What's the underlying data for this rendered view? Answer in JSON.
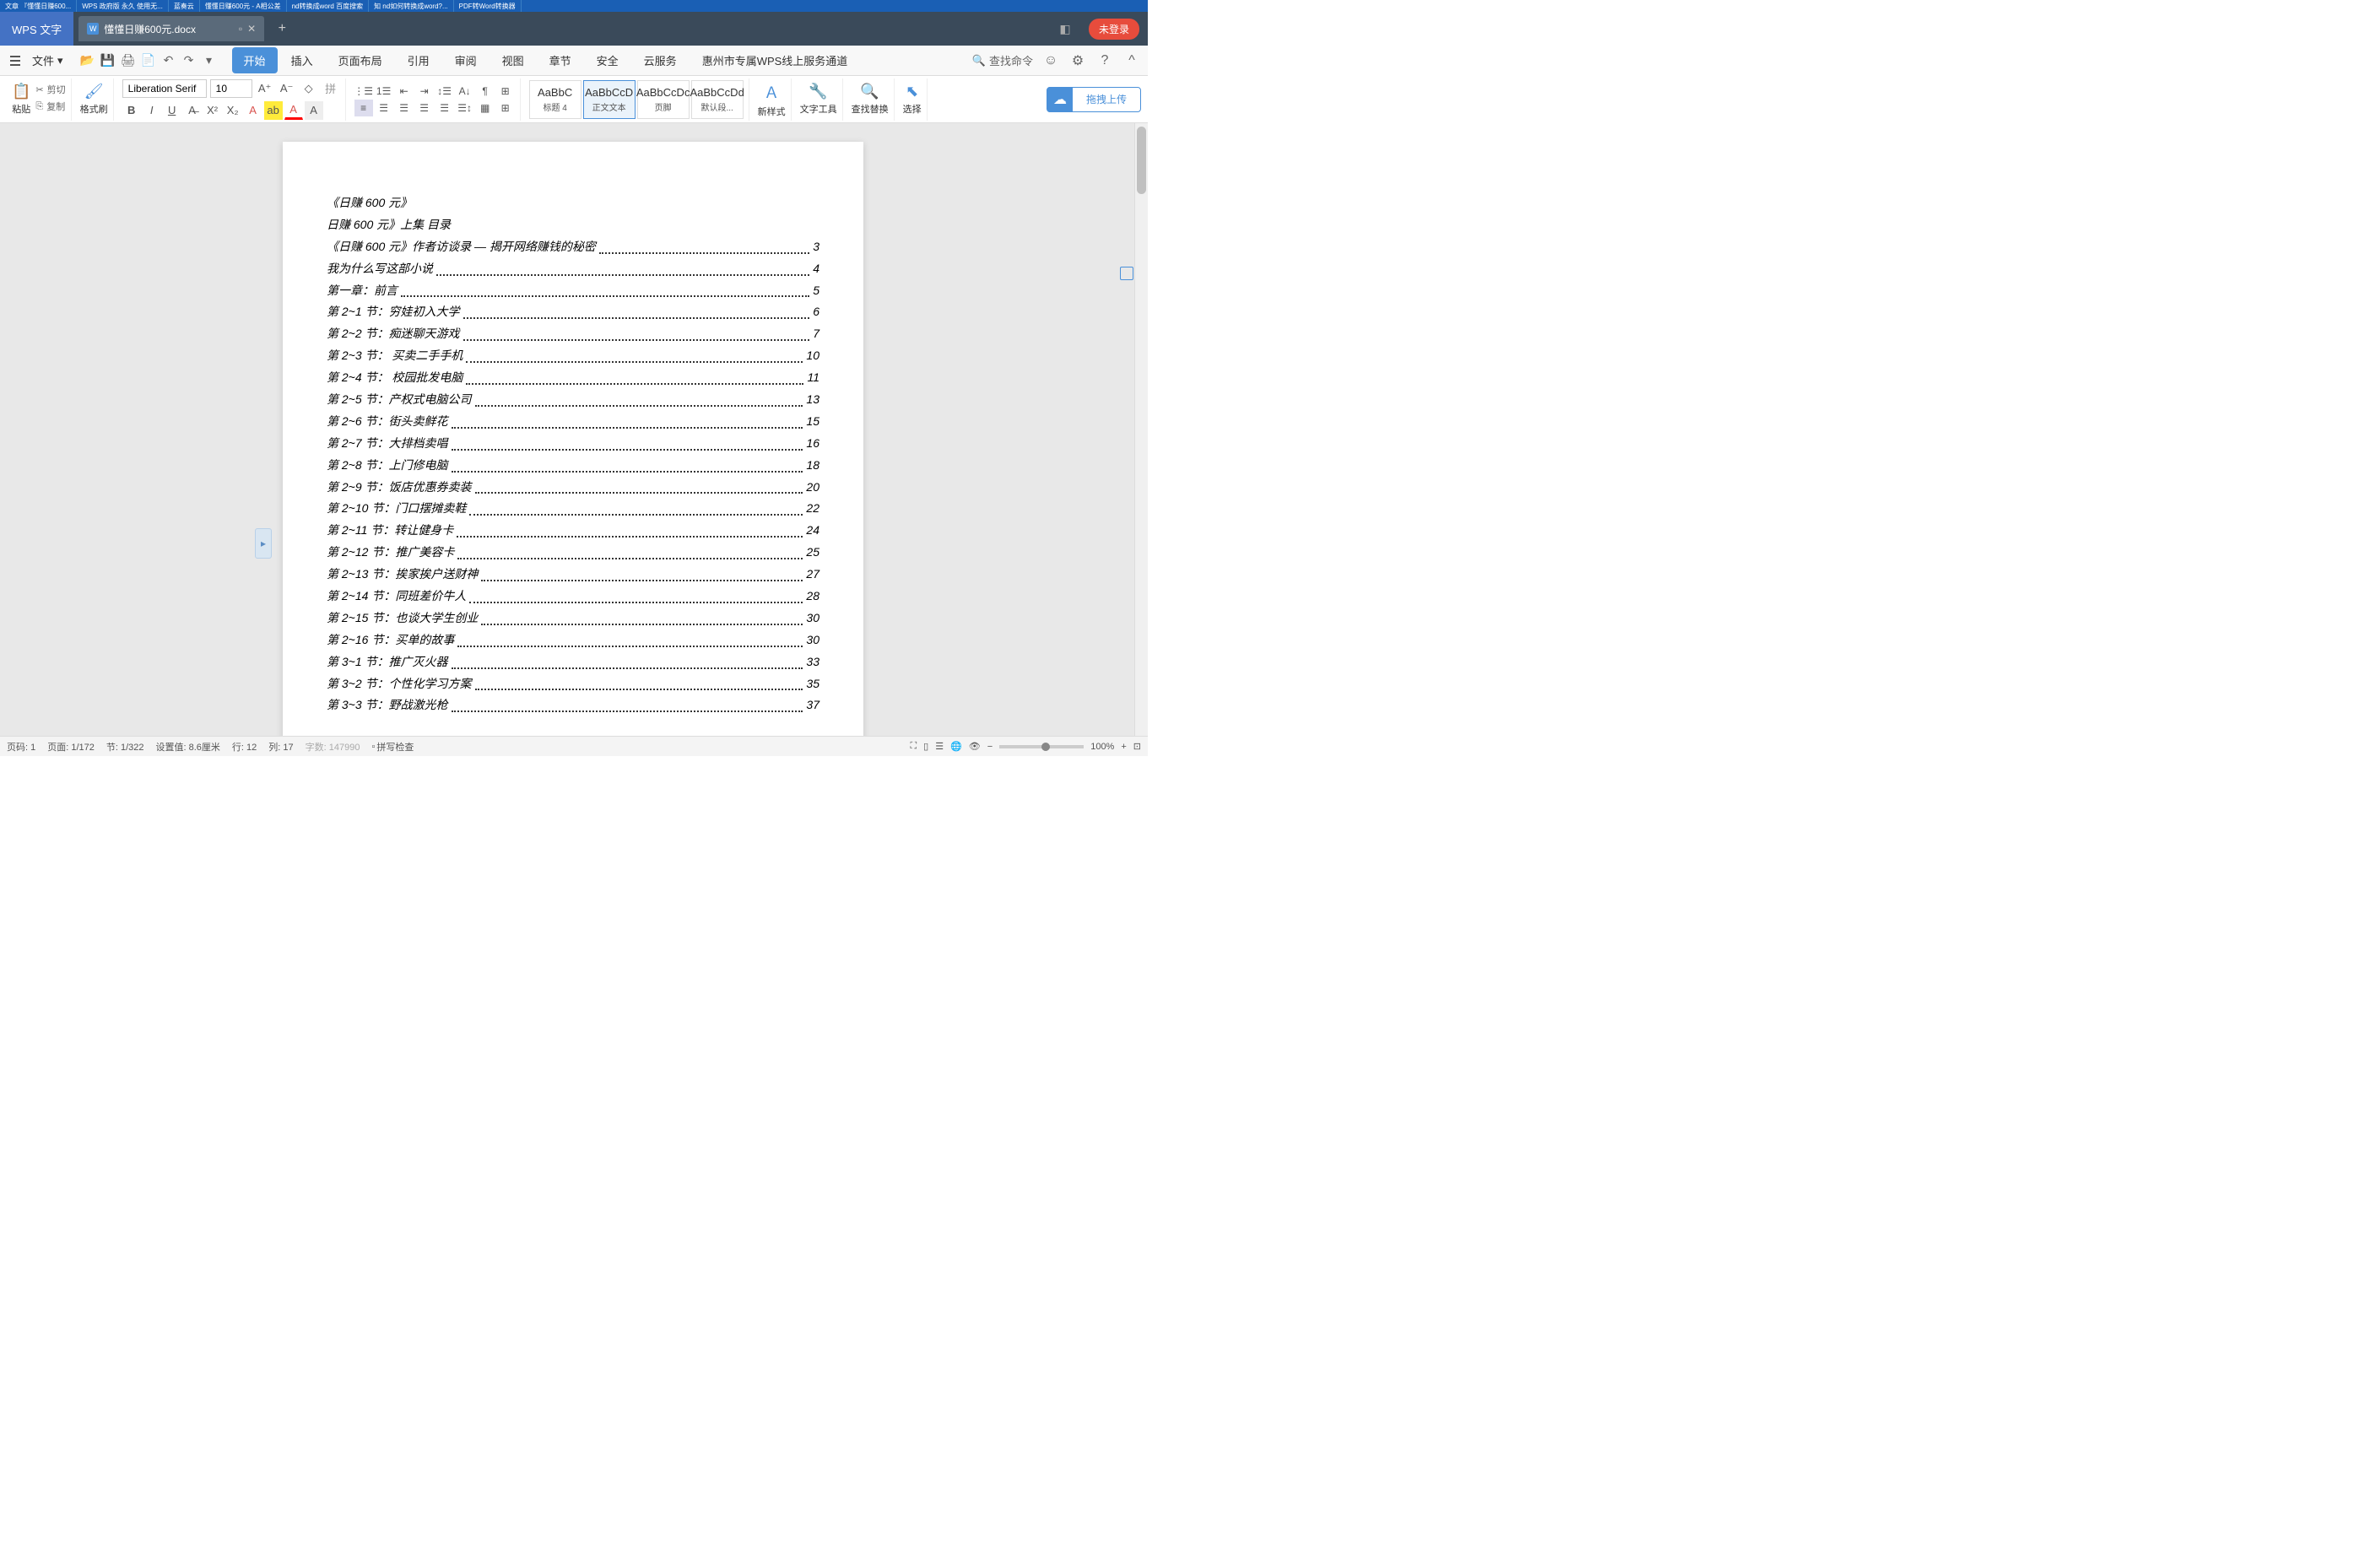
{
  "browser_tabs": [
    "文章 『懂懂日赚600...",
    "WPS 政府版 永久 使用无...",
    "蓝奏云",
    "懂懂日赚600元 - A相公差",
    "nd转换成word 百度搜索",
    "知 nd如何转换成word?...",
    "PDF转Word转换器"
  ],
  "app": {
    "name": "WPS 文字",
    "login": "未登录"
  },
  "doc_tab": {
    "icon": "W",
    "name": "懂懂日赚600元.docx"
  },
  "file_menu": "文件",
  "tabs": [
    "开始",
    "插入",
    "页面布局",
    "引用",
    "审阅",
    "视图",
    "章节",
    "安全",
    "云服务",
    "惠州市专属WPS线上服务通道"
  ],
  "search_cmd": "查找命令",
  "clipboard": {
    "paste": "粘贴",
    "cut": "剪切",
    "copy": "复制",
    "format": "格式刷"
  },
  "font": {
    "family": "Liberation Serif",
    "size": "10"
  },
  "styles": [
    {
      "preview": "AaBbC",
      "label": "标题 4"
    },
    {
      "preview": "AaBbCcD",
      "label": "正文文本"
    },
    {
      "preview": "AaBbCcDc",
      "label": "页脚"
    },
    {
      "preview": "AaBbCcDd",
      "label": "默认段..."
    }
  ],
  "ribbon_right": {
    "newstyle": "新样式",
    "texttools": "文字工具",
    "findreplace": "查找替换",
    "select": "选择",
    "upload": "拖拽上传"
  },
  "document": {
    "title": "《日赚 600 元》",
    "subtitle": "日赚 600 元》上集 目录",
    "toc": [
      {
        "text": "《日赚 600 元》作者访谈录 — 揭开网络赚钱的秘密",
        "page": "3"
      },
      {
        "text": "我为什么写这部小说",
        "page": "4"
      },
      {
        "text": "第一章：前言",
        "page": "5"
      },
      {
        "text": "第 2~1 节：穷娃初入大学",
        "page": "6"
      },
      {
        "text": "第 2~2 节：痴迷聊天游戏",
        "page": "7"
      },
      {
        "text": "第 2~3 节： 买卖二手手机",
        "page": "10"
      },
      {
        "text": "第 2~4 节： 校园批发电脑",
        "page": "11"
      },
      {
        "text": "第 2~5 节：产权式电脑公司",
        "page": "13"
      },
      {
        "text": "第 2~6 节：街头卖鲜花",
        "page": "15"
      },
      {
        "text": "第 2~7 节：大排档卖唱",
        "page": "16"
      },
      {
        "text": "第 2~8 节：上门修电脑",
        "page": "18"
      },
      {
        "text": "第 2~9 节：饭店优惠券卖装",
        "page": "20"
      },
      {
        "text": "第 2~10 节：门口摆摊卖鞋",
        "page": "22"
      },
      {
        "text": "第 2~11 节：转让健身卡",
        "page": "24"
      },
      {
        "text": "第 2~12 节：推广美容卡",
        "page": "25"
      },
      {
        "text": "第 2~13 节：挨家挨户送财神",
        "page": "27"
      },
      {
        "text": "第 2~14 节：同班差价牛人",
        "page": "28"
      },
      {
        "text": "第 2~15 节：也谈大学生创业",
        "page": "30"
      },
      {
        "text": "第 2~16 节：买单的故事",
        "page": "30"
      },
      {
        "text": "第 3~1 节：推广灭火器",
        "page": "33"
      },
      {
        "text": "第 3~2 节：个性化学习方案",
        "page": "35"
      },
      {
        "text": "第 3~3 节：野战激光枪",
        "page": "37"
      }
    ]
  },
  "status": {
    "page": "页码: 1",
    "pages": "页面: 1/172",
    "section": "节: 1/322",
    "setval": "设置值: 8.6厘米",
    "row": "行: 12",
    "col": "列: 17",
    "words": "字数: 147990",
    "spell": "拼写检查",
    "zoom": "100%"
  }
}
